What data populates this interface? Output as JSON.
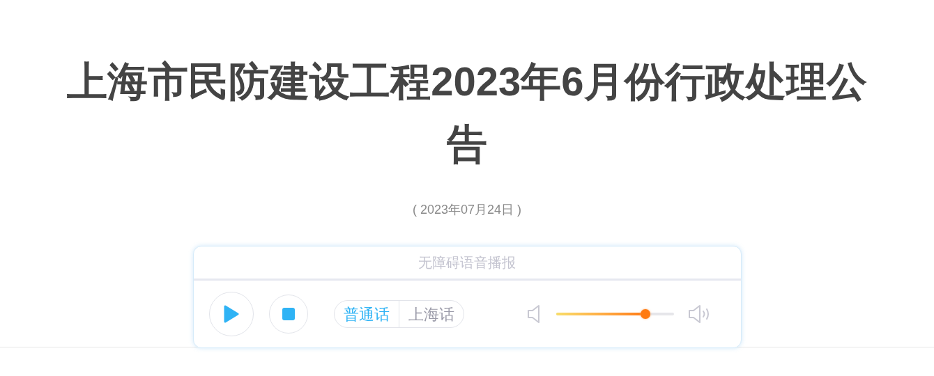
{
  "title": "上海市民防建设工程2023年6月份行政处理公告",
  "date": "( 2023年07月24日 )",
  "player": {
    "header": "无障碍语音播报",
    "languages": [
      {
        "label": "普通话",
        "selected": true
      },
      {
        "label": "上海话",
        "selected": false
      }
    ],
    "volume": {
      "level": 0.76
    }
  }
}
